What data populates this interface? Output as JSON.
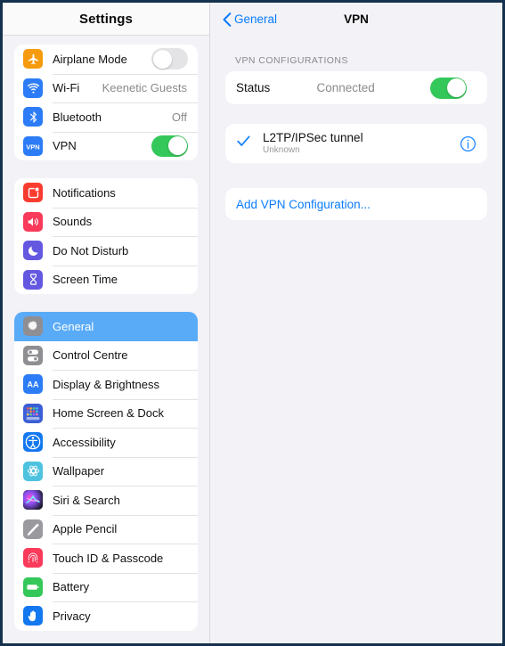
{
  "window": {
    "border_color": "#16314d"
  },
  "sidebar": {
    "title": "Settings",
    "groups": [
      {
        "items": [
          {
            "label": "Airplane Mode",
            "icon": "airplane-icon",
            "icon_color": "#f59b0d",
            "control": "toggle",
            "toggle_state": "off"
          },
          {
            "label": "Wi-Fi",
            "icon": "wifi-icon",
            "icon_color": "#2b7cf6",
            "control": "value",
            "value": "Keenetic Guests"
          },
          {
            "label": "Bluetooth",
            "icon": "bluetooth-icon",
            "icon_color": "#2b7cf6",
            "control": "value",
            "value": "Off"
          },
          {
            "label": "VPN",
            "icon": "vpn-icon",
            "icon_color": "#2b7cf6",
            "control": "toggle",
            "toggle_state": "on"
          }
        ]
      },
      {
        "items": [
          {
            "label": "Notifications",
            "icon": "notifications-icon",
            "icon_color": "#fa3c30"
          },
          {
            "label": "Sounds",
            "icon": "sounds-icon",
            "icon_color": "#f93a5a"
          },
          {
            "label": "Do Not Disturb",
            "icon": "moon-icon",
            "icon_color": "#6558e0"
          },
          {
            "label": "Screen Time",
            "icon": "hourglass-icon",
            "icon_color": "#6558e0"
          }
        ]
      },
      {
        "items": [
          {
            "label": "General",
            "icon": "gear-icon",
            "icon_color": "#8e8e93",
            "selected": true
          },
          {
            "label": "Control Centre",
            "icon": "control-centre-icon",
            "icon_color": "#8e8e93"
          },
          {
            "label": "Display & Brightness",
            "icon": "display-brightness-icon",
            "icon_color": "#2b7cf6"
          },
          {
            "label": "Home Screen & Dock",
            "icon": "home-screen-dock-icon",
            "icon_color": "#3b5fd6"
          },
          {
            "label": "Accessibility",
            "icon": "accessibility-icon",
            "icon_color": "#1378f0"
          },
          {
            "label": "Wallpaper",
            "icon": "wallpaper-icon",
            "icon_color": "#4ec3e0"
          },
          {
            "label": "Siri & Search",
            "icon": "siri-icon",
            "icon_color": "#1c1c2e"
          },
          {
            "label": "Apple Pencil",
            "icon": "apple-pencil-icon",
            "icon_color": "#9a9a9e"
          },
          {
            "label": "Touch ID & Passcode",
            "icon": "touch-id-icon",
            "icon_color": "#f93a5a"
          },
          {
            "label": "Battery",
            "icon": "battery-icon",
            "icon_color": "#34c759"
          },
          {
            "label": "Privacy",
            "icon": "privacy-hand-icon",
            "icon_color": "#1378f0"
          }
        ]
      }
    ]
  },
  "detail": {
    "back_label": "General",
    "title": "VPN",
    "section_label": "VPN CONFIGURATIONS",
    "status": {
      "label": "Status",
      "value": "Connected",
      "toggle_state": "on"
    },
    "configuration": {
      "name": "L2TP/IPSec tunnel",
      "subtitle": "Unknown",
      "selected": true
    },
    "add_label": "Add VPN Configuration..."
  },
  "colors": {
    "accent_blue": "#0a7cff",
    "toggle_green": "#34c759",
    "selected_row": "#5aabf7"
  }
}
